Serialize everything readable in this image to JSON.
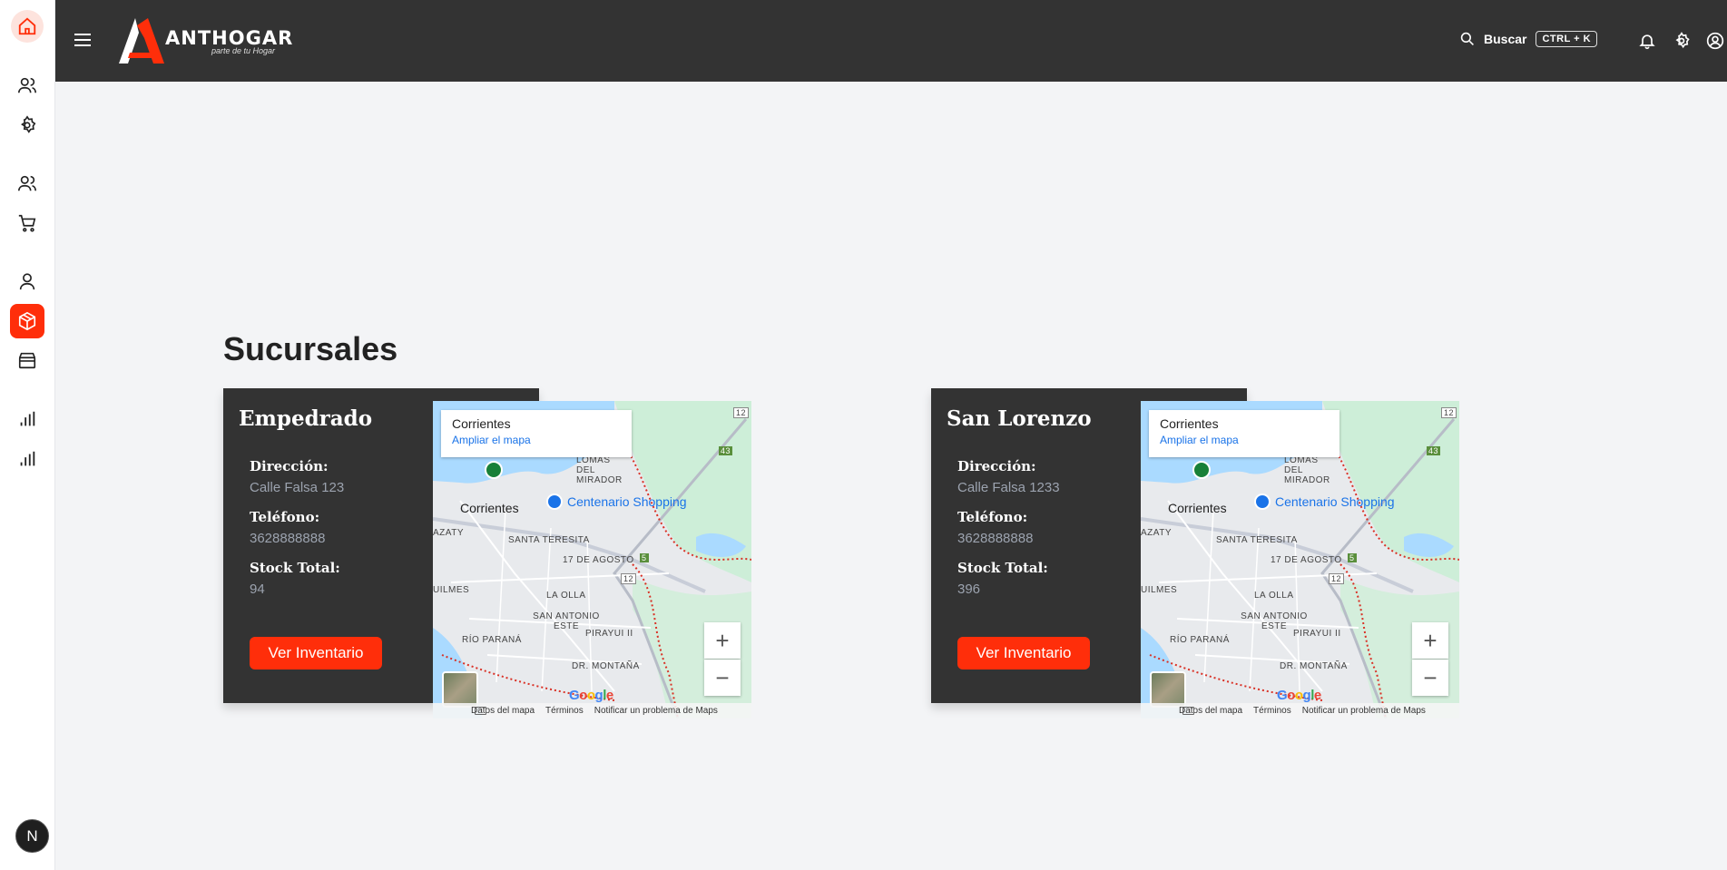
{
  "header": {
    "logo_text": "ANTHOGAR",
    "logo_tagline": "parte de tu Hogar",
    "search_label": "Buscar",
    "search_shortcut": "CTRL + K"
  },
  "sidebar": {
    "avatar_initial": "N"
  },
  "page": {
    "title": "Sucursales"
  },
  "labels": {
    "direccion": "Dirección:",
    "telefono": "Teléfono:",
    "stock": "Stock Total:",
    "button": "Ver Inventario"
  },
  "branches": [
    {
      "name": "Empedrado",
      "address": "Calle Falsa 123",
      "phone": "3628888888",
      "stock": "94"
    },
    {
      "name": "San Lorenzo",
      "address": "Calle Falsa 1233",
      "phone": "3628888888",
      "stock": "396"
    }
  ],
  "map": {
    "place_title": "Corrientes",
    "place_link": "Ampliar el mapa",
    "city_label": "Corrientes",
    "shop_label": "Centenario Shopping",
    "areas": [
      "LOMAS DEL MIRADOR",
      "SANTA TERESITA",
      "17 DE AGOSTO",
      "LA OLLA",
      "SAN ANTONIO ESTE",
      "PIRAYUI II",
      "RÍO PARANÁ",
      "DR. MONTAÑA",
      "UILMES",
      "AZATY"
    ],
    "road_numbers": [
      "12",
      "43",
      "5",
      "12"
    ],
    "zoom_in": "+",
    "zoom_out": "−",
    "google": "Google",
    "footer": [
      "Datos del mapa",
      "Términos",
      "Notificar un problema de Maps"
    ]
  }
}
